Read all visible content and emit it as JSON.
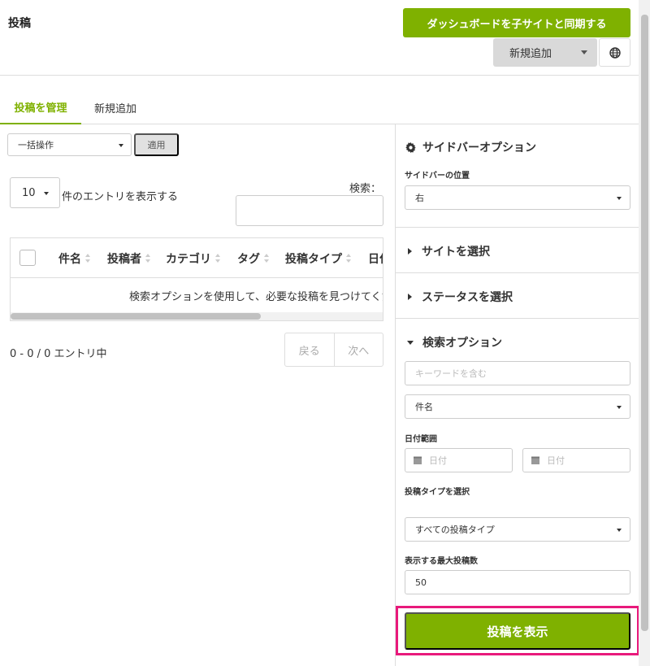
{
  "header": {
    "title": "投稿",
    "sync_button": "ダッシュボードを子サイトと同期する",
    "add_new_button": "新規追加"
  },
  "tabs": [
    {
      "label": "投稿を管理",
      "active": true
    },
    {
      "label": "新規追加",
      "active": false
    }
  ],
  "toolbar": {
    "bulk_action": "一括操作",
    "apply": "適用"
  },
  "table_controls": {
    "length_value": "10",
    "length_text": "件のエントリを表示する",
    "search_label": "検索："
  },
  "table": {
    "columns": [
      "件名",
      "投稿者",
      "カテゴリ",
      "タグ",
      "投稿タイプ",
      "日付"
    ],
    "empty_message": "検索オプションを使用して、必要な投稿を見つけてください"
  },
  "footer": {
    "info": "0 - 0 / 0 エントリ中",
    "prev": "戻る",
    "next": "次へ"
  },
  "sidebar": {
    "title": "サイドバーオプション",
    "position_label": "サイドバーの位置",
    "position_value": "右",
    "sections": {
      "select_site": "サイトを選択",
      "select_status": "ステータスを選択",
      "search_options": "検索オプション"
    },
    "keyword_placeholder": "キーワードを含む",
    "field_select": "件名",
    "date_range_label": "日付範囲",
    "date_from_placeholder": "日付",
    "date_to_placeholder": "日付",
    "post_type_label": "投稿タイプを選択",
    "post_type_value": "すべての投稿タイプ",
    "max_posts_label": "表示する最大投稿数",
    "max_posts_value": "50",
    "show_button": "投稿を表示"
  },
  "colors": {
    "accent": "#7fb100",
    "highlight": "#e8197b"
  }
}
